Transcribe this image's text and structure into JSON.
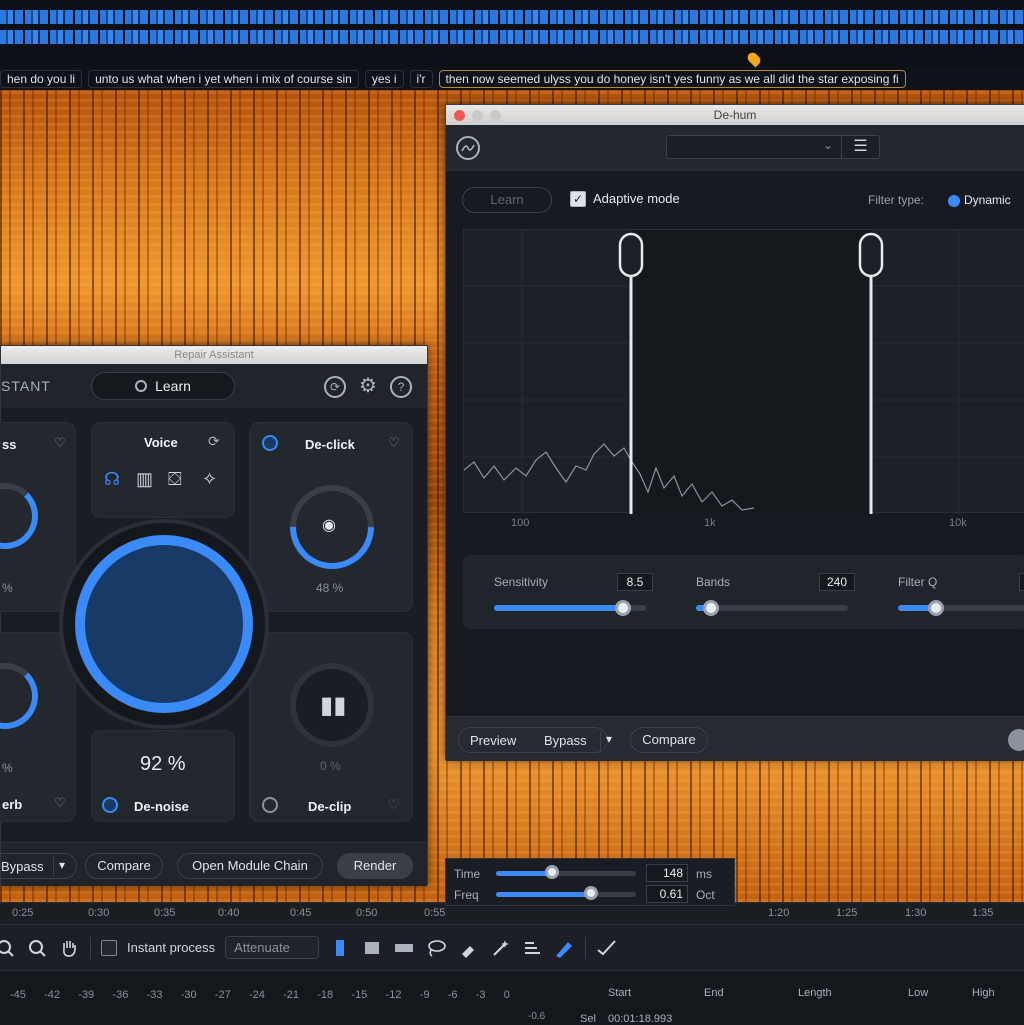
{
  "transcript": {
    "chips": [
      "hen do you li",
      "unto us what when i yet when i mix of course sin",
      "yes i",
      "i'r",
      "then now seemed ulyss you do honey isn't yes funny as we all did the star exposing fi"
    ]
  },
  "timeline": {
    "ticks": [
      "0:25",
      "0:30",
      "0:35",
      "0:40",
      "0:45",
      "0:50",
      "0:55",
      "1:20",
      "1:25",
      "1:30",
      "1:35"
    ]
  },
  "toolbar": {
    "instant_process_label": "Instant process",
    "attenuate_value": "Attenuate"
  },
  "meter": {
    "ticks": [
      "-45",
      "-42",
      "-39",
      "-36",
      "-33",
      "-30",
      "-27",
      "-24",
      "-21",
      "-18",
      "-15",
      "-12",
      "-9",
      "-6",
      "-3",
      "0"
    ],
    "side_value": "-0.6"
  },
  "selection": {
    "headers": [
      "Start",
      "End",
      "Length",
      "Low",
      "High"
    ],
    "sel_label": "Sel",
    "sel_start": "00:01:18.993"
  },
  "dehum": {
    "title": "De-hum",
    "learn_label": "Learn",
    "adaptive_label": "Adaptive mode",
    "filter_type_label": "Filter type:",
    "filter_type_value": "Dynamic",
    "freq_labels": [
      "100",
      "1k",
      "10k"
    ],
    "sensitivity_label": "Sensitivity",
    "sensitivity_value": "8.5",
    "bands_label": "Bands",
    "bands_value": "240",
    "filterq_label": "Filter Q",
    "preview_label": "Preview",
    "bypass_label": "Bypass",
    "bypass_arrow": "▾",
    "compare_label": "Compare",
    "sensitivity_level": 0.85,
    "bands_level": 0.1,
    "filterq_level": 0.3
  },
  "repair": {
    "title": "Repair Assistant",
    "assistant_label": "STANT",
    "learn_label": "Learn",
    "modules": {
      "top_left_title": "ss",
      "top_left_value": "%",
      "voice_title": "Voice",
      "declick_title": "De-click",
      "declick_value": "48 %",
      "bottom_left_title": "erb",
      "bottom_left_value": "%",
      "denoise_title": "De-noise",
      "denoise_value": "92 %",
      "declip_title": "De-clip",
      "declip_value": "0 %"
    },
    "bypass_label": "Bypass",
    "bypass_arrow": "▾",
    "compare_label": "Compare",
    "module_chain_label": "Open Module Chain",
    "render_label": "Render"
  },
  "tfpanel": {
    "time_label": "Time",
    "time_value": "148",
    "time_unit": "ms",
    "freq_label": "Freq",
    "freq_value": "0.61",
    "freq_unit": "Oct",
    "time_level": 0.4,
    "freq_level": 0.68
  },
  "colors": {
    "accent": "#3d8af7",
    "spectrogram": "#e08222",
    "playhead": "#f2a81d"
  }
}
